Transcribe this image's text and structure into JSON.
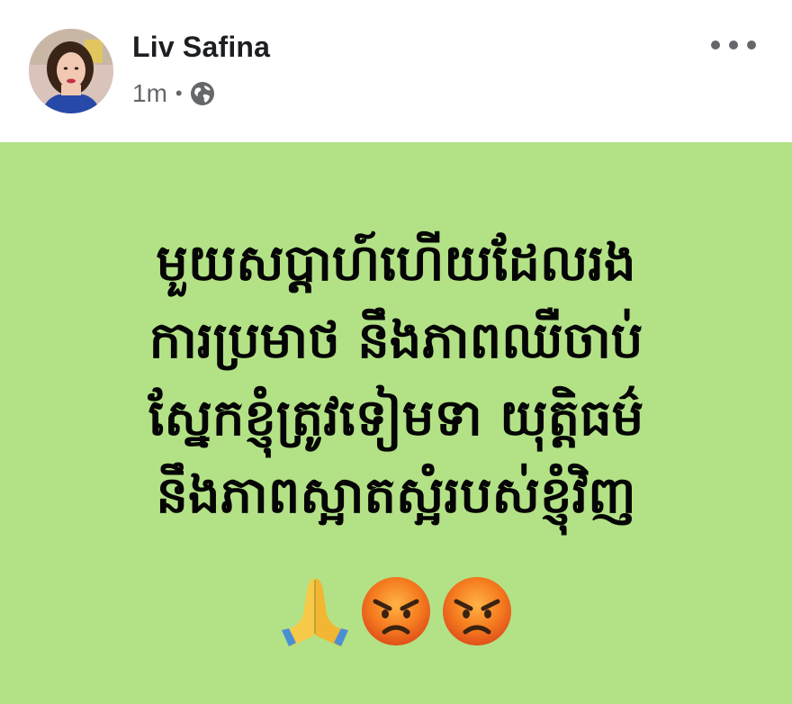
{
  "post": {
    "author_name": "Liv Safina",
    "timestamp": "1m",
    "separator": "•",
    "audience_icon": "globe-icon",
    "menu_icon": "more-options-icon"
  },
  "content": {
    "background_color": "#b3e286",
    "lines": [
      "មួយសប្តាហ៍ហើយដែលរង",
      "ការប្រមាថ  នឹងភាពឈឺចាប់",
      "ស្នែកខ្ញុំត្រូវទៀមទា យុត្តិធម៌",
      "នឹងភាពស្អាតស្អំរបស់ខ្ញុំវិញ"
    ],
    "emojis": [
      "folded-hands-emoji",
      "angry-face-emoji",
      "angry-face-emoji"
    ]
  }
}
